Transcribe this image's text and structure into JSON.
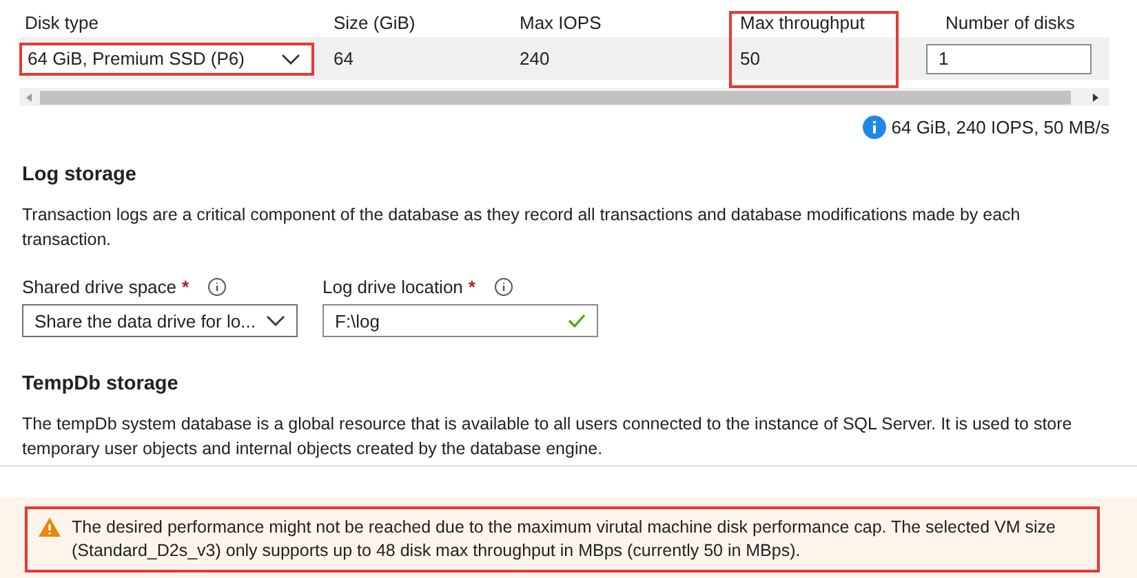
{
  "disk_table": {
    "columns": [
      {
        "label": "Disk type",
        "highlighted": false
      },
      {
        "label": "Size (GiB)",
        "highlighted": false
      },
      {
        "label": "Max IOPS",
        "highlighted": false
      },
      {
        "label": "Max throughput",
        "highlighted": true
      },
      {
        "label": "Number of disks",
        "highlighted": false
      }
    ],
    "row": {
      "disk_type": {
        "value": "64 GiB, Premium SSD (P6)",
        "highlighted": true
      },
      "size": "64",
      "iops": "240",
      "throughput": "50",
      "disks": "1"
    },
    "summary": "64 GiB, 240 IOPS, 50 MB/s"
  },
  "log_storage": {
    "title": "Log storage",
    "description": "Transaction logs are a critical component of the database as they record all transactions and database modifications made by each transaction.",
    "fields": [
      {
        "kind": "select",
        "label": "Shared drive space",
        "required": "*",
        "value": "Share the data drive for lo...",
        "valid": false
      },
      {
        "kind": "text",
        "label": "Log drive location",
        "required": "*",
        "value": "F:\\log",
        "valid": true
      }
    ]
  },
  "tempdb_storage": {
    "title": "TempDb storage",
    "description": "The tempDb system database is a global resource that is available to all users connected to the instance of SQL Server. It is used to store temporary user objects and internal objects created by the database engine."
  },
  "warning": {
    "text": "The desired performance might not be reached due to the maximum virutal machine disk performance cap. The selected VM size (Standard_D2s_v3) only supports up to 48 disk max throughput in MBps (currently 50 in MBps).",
    "highlighted": true
  }
}
